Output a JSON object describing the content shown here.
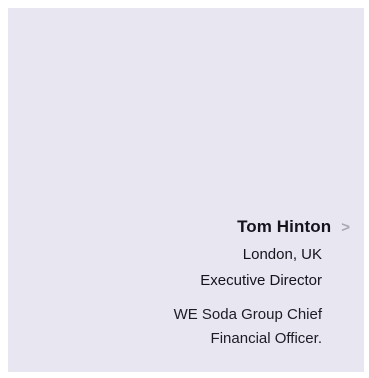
{
  "profile": {
    "name": "Tom Hinton",
    "location": "London, UK",
    "role": "Executive Director",
    "description_line1": "WE Soda Group Chief",
    "description_line2": "Financial Officer.",
    "chevron_glyph": ">"
  },
  "colors": {
    "card_background": "#e8e6f0",
    "text": "#14141c",
    "chevron": "#a9a7b6"
  },
  "icons": {
    "chevron": "chevron-right-icon"
  }
}
